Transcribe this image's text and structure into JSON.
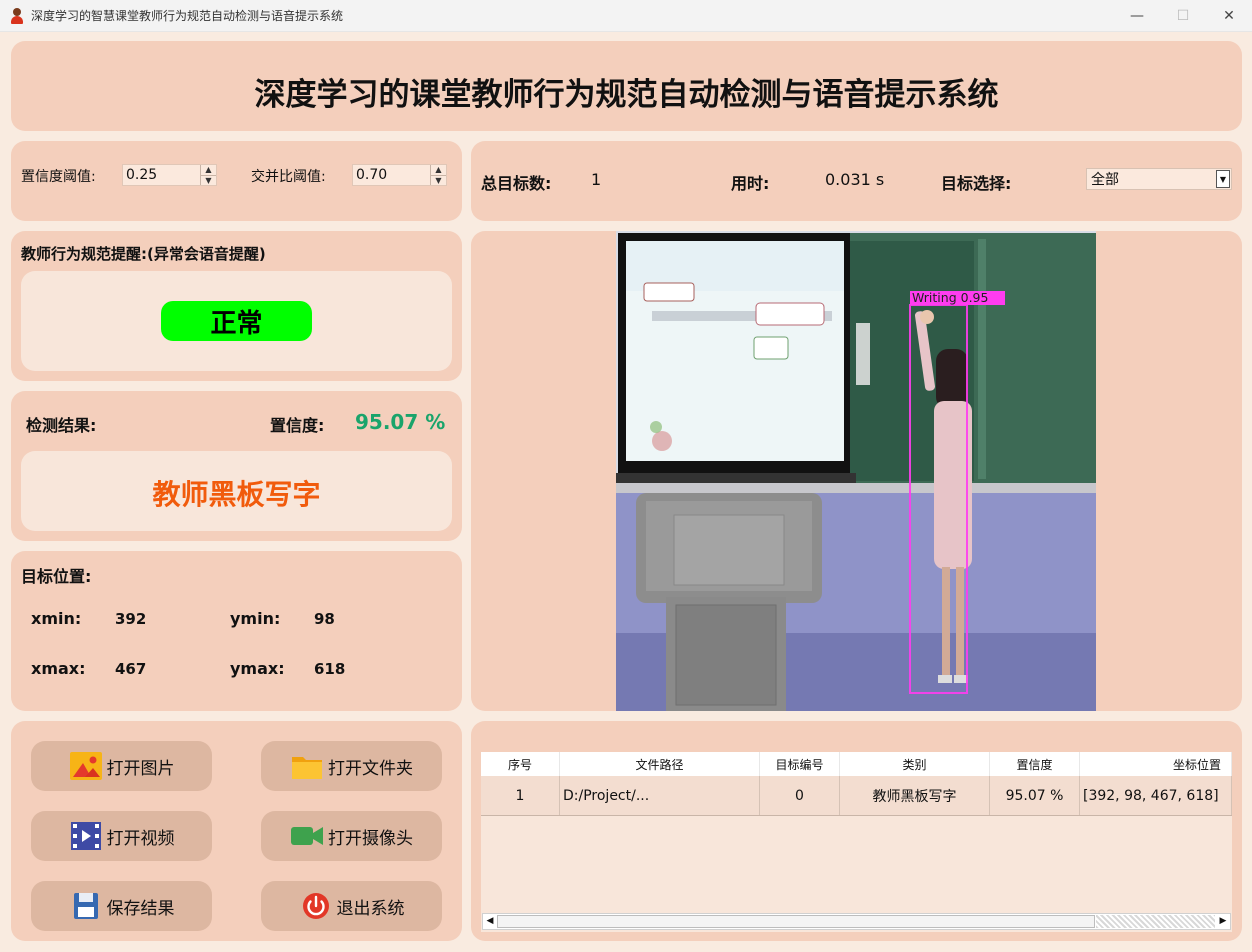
{
  "window": {
    "title": "深度学习的智慧课堂教师行为规范自动检测与语音提示系统"
  },
  "header": {
    "title": "深度学习的课堂教师行为规范自动检测与语音提示系统"
  },
  "params": {
    "conf_label": "置信度阈值:",
    "conf_value": "0.25",
    "iou_label": "交并比阈值:",
    "iou_value": "0.70"
  },
  "stats": {
    "total_label": "总目标数:",
    "total_value": "1",
    "time_label": "用时:",
    "time_value": "0.031 s",
    "select_label": "目标选择:",
    "select_value": "全部"
  },
  "reminder": {
    "label": "教师行为规范提醒:(异常会语音提醒)",
    "status": "正常",
    "status_color": "#00ff00"
  },
  "result": {
    "label": "检测结果:",
    "conf_label": "置信度:",
    "conf_value": "95.07 %",
    "value": "教师黑板写字",
    "value_color": "#f15b0c",
    "conf_color": "#1aa46b"
  },
  "position": {
    "label": "目标位置:",
    "xmin_label": "xmin:",
    "xmin": "392",
    "ymin_label": "ymin:",
    "ymin": "98",
    "xmax_label": "xmax:",
    "xmax": "467",
    "ymax_label": "ymax:",
    "ymax": "618"
  },
  "image": {
    "detection_label": "Writing 0.95",
    "box_color": "#ff3cf0"
  },
  "buttons": {
    "open_image": "打开图片",
    "open_folder": "打开文件夹",
    "open_video": "打开视频",
    "open_camera": "打开摄像头",
    "save": "保存结果",
    "exit": "退出系统"
  },
  "table": {
    "headers": [
      "序号",
      "文件路径",
      "目标编号",
      "类别",
      "置信度",
      "坐标位置"
    ],
    "rows": [
      [
        "1",
        "D:/Project/...",
        "0",
        "教师黑板写字",
        "95.07 %",
        "[392, 98, 467, 618]"
      ]
    ]
  }
}
